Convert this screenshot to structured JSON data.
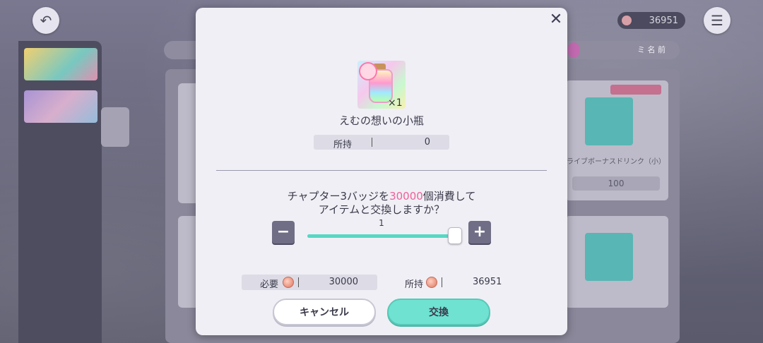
{
  "header": {
    "coin_count": "36951"
  },
  "background": {
    "tab_label": "ミ 名 前",
    "card_price": "100",
    "card_name": "ライブボーナスドリンク（小）"
  },
  "dialog": {
    "item_name": "えむの想いの小瓶",
    "item_qty": "×1",
    "owned_label": "所持",
    "owned_value": "0",
    "message_line1_prefix": "チャプター3バッジを",
    "message_amount": "30000",
    "message_line1_suffix": "個消費して",
    "message_line2": "アイテムと交換しますか？",
    "quantity": "1",
    "quantity_fraction": 1.0,
    "required_label": "必要",
    "required_value": "30000",
    "have_label": "所持",
    "have_value": "36951",
    "cancel_label": "キャンセル",
    "confirm_label": "交換"
  },
  "colors": {
    "accent": "#6fe2d2",
    "highlight": "#f0609a"
  },
  "icons": {
    "back": "back-arrow-icon",
    "menu": "hamburger-icon",
    "close": "close-icon",
    "badge": "chapter-badge-icon"
  }
}
